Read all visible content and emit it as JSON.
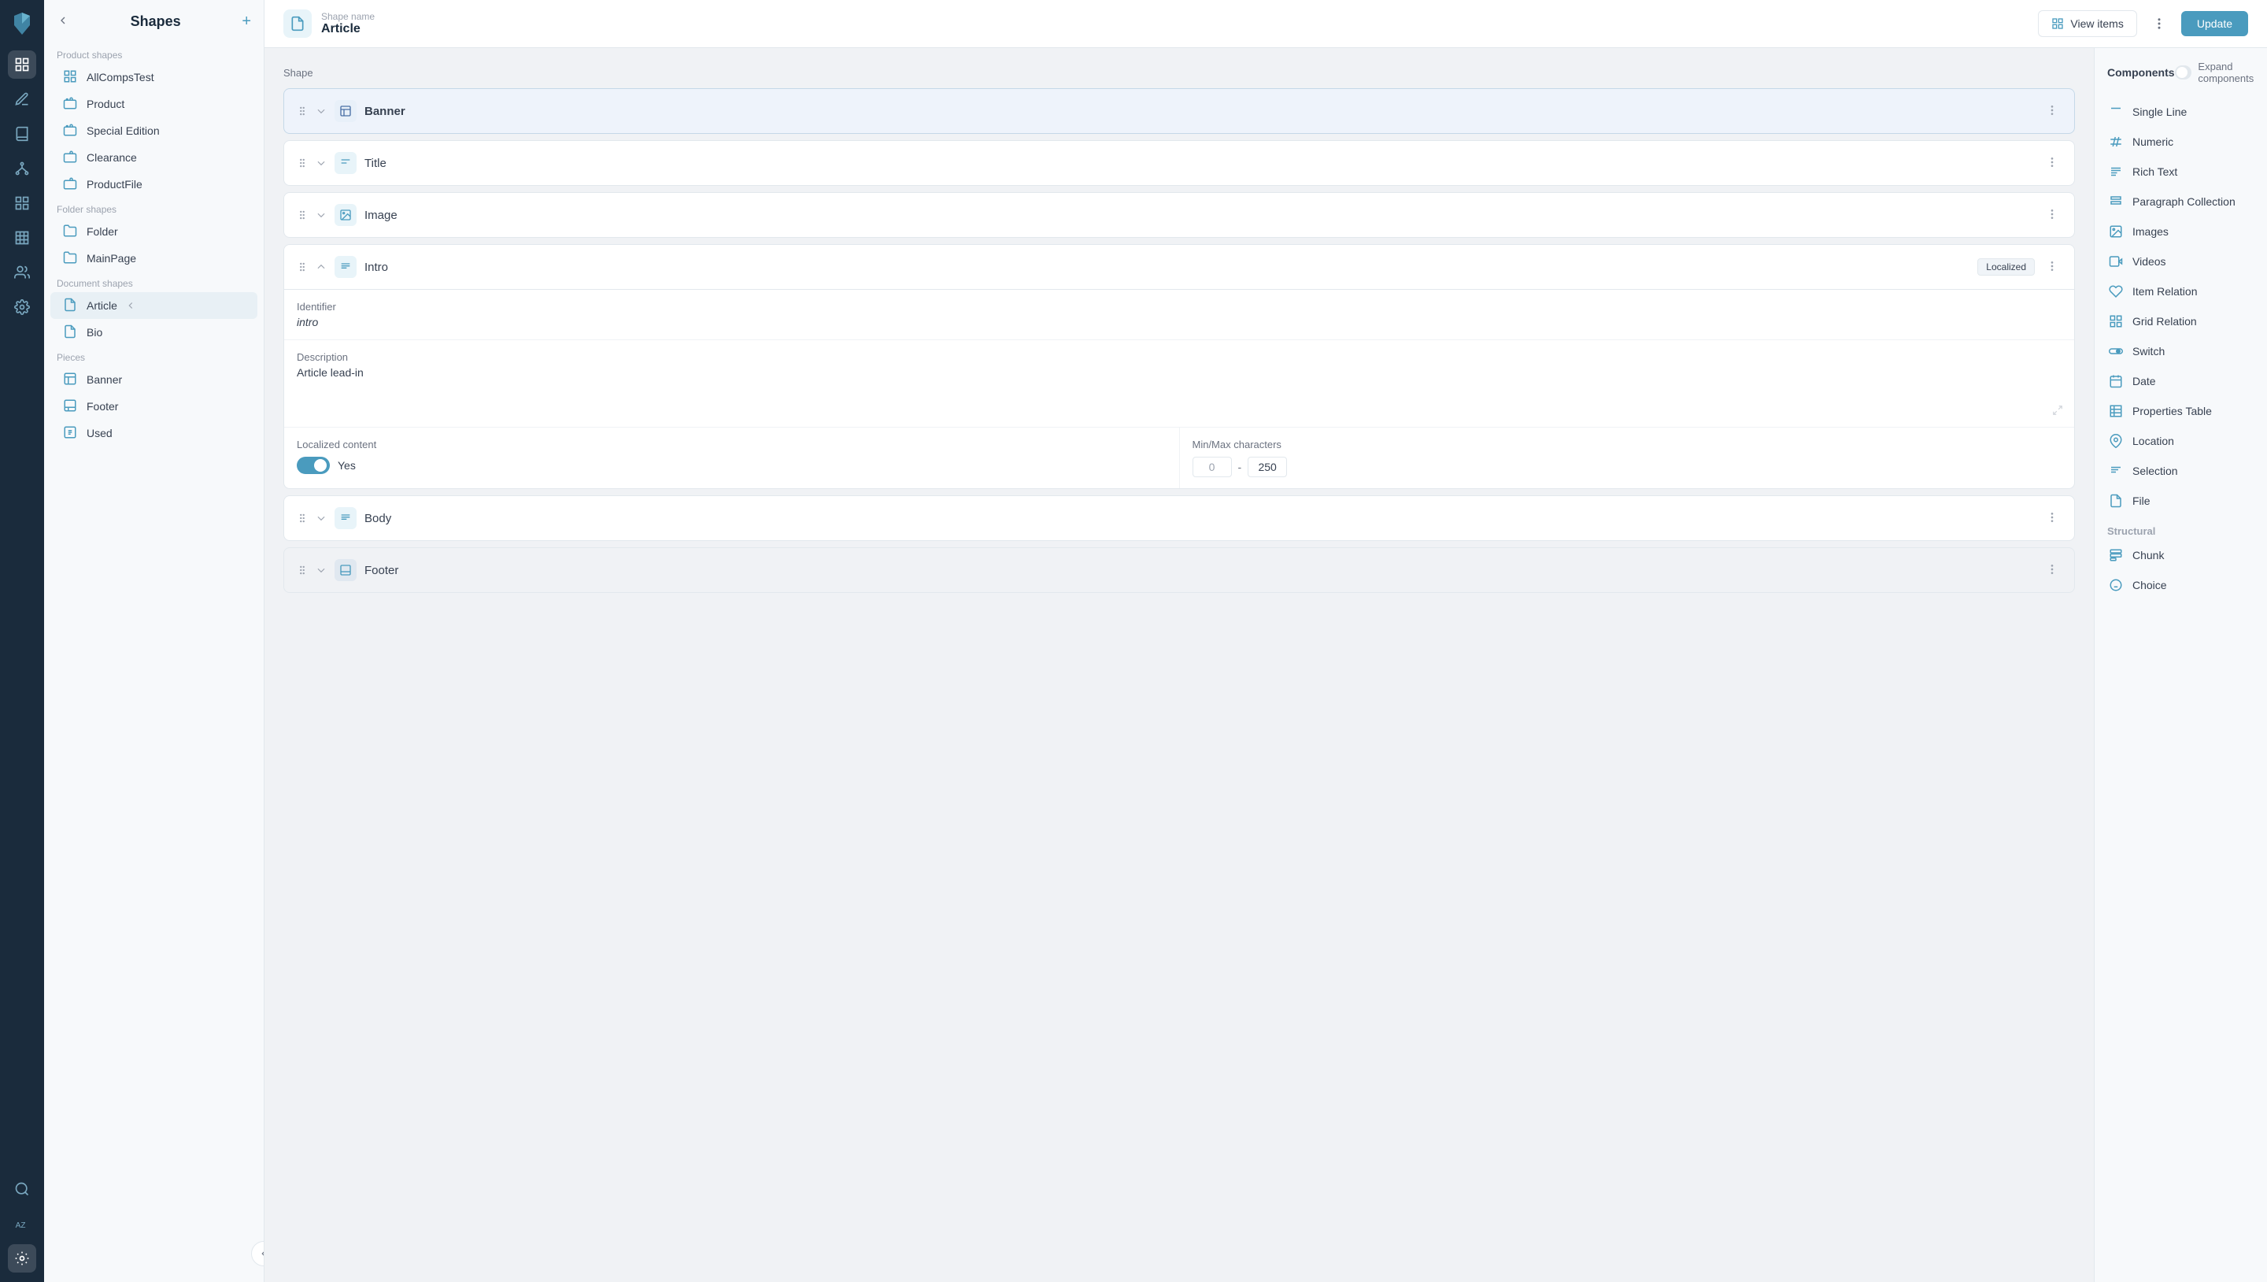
{
  "app": {
    "title": "Shapes"
  },
  "sidebar": {
    "back_label": "←",
    "add_label": "+",
    "title": "Shapes",
    "sections": [
      {
        "label": "Product shapes",
        "items": [
          {
            "id": "allcompstest",
            "label": "AllCompsTest",
            "icon": "grid"
          },
          {
            "id": "product",
            "label": "Product",
            "icon": "box"
          },
          {
            "id": "special-edition",
            "label": "Special Edition",
            "icon": "box"
          },
          {
            "id": "clearance",
            "label": "Clearance",
            "icon": "box"
          },
          {
            "id": "productfile",
            "label": "ProductFile",
            "icon": "box"
          }
        ]
      },
      {
        "label": "Folder shapes",
        "items": [
          {
            "id": "folder",
            "label": "Folder",
            "icon": "folder"
          },
          {
            "id": "mainpage",
            "label": "MainPage",
            "icon": "folder"
          }
        ]
      },
      {
        "label": "Document shapes",
        "items": [
          {
            "id": "article",
            "label": "Article",
            "icon": "doc",
            "active": true
          },
          {
            "id": "bio",
            "label": "Bio",
            "icon": "doc"
          }
        ]
      },
      {
        "label": "Pieces",
        "items": [
          {
            "id": "banner",
            "label": "Banner",
            "icon": "piece"
          },
          {
            "id": "footer",
            "label": "Footer",
            "icon": "piece"
          },
          {
            "id": "used",
            "label": "Used",
            "icon": "piece"
          }
        ]
      }
    ]
  },
  "topbar": {
    "shape_name_label": "Shape name",
    "shape_name": "Article",
    "view_items_label": "View items",
    "update_label": "Update"
  },
  "editor": {
    "section_label": "Shape",
    "expand_components_label": "Expand components",
    "rows": [
      {
        "id": "banner",
        "label": "Banner",
        "type": "piece",
        "active": true,
        "expanded": false
      },
      {
        "id": "title",
        "label": "Title",
        "type": "single-line",
        "active": false,
        "expanded": false
      },
      {
        "id": "image",
        "label": "Image",
        "type": "image",
        "active": false,
        "expanded": false
      },
      {
        "id": "intro",
        "label": "Intro",
        "type": "rich-text",
        "active": false,
        "expanded": true,
        "badge": "Localized",
        "identifier": "intro",
        "description": "Article lead-in",
        "localized_label": "Localized content",
        "localized_value": "Yes",
        "minmax_label": "Min/Max characters",
        "min_value": "0",
        "max_value": "250"
      },
      {
        "id": "body",
        "label": "Body",
        "type": "rich-text",
        "active": false,
        "expanded": false
      },
      {
        "id": "footer",
        "label": "Footer",
        "type": "piece",
        "active": false,
        "expanded": false
      }
    ]
  },
  "components": {
    "title": "Components",
    "expand_label": "Expand components",
    "items": [
      {
        "id": "single-line",
        "label": "Single Line",
        "icon": "single-line"
      },
      {
        "id": "numeric",
        "label": "Numeric",
        "icon": "numeric"
      },
      {
        "id": "rich-text",
        "label": "Rich Text",
        "icon": "rich-text"
      },
      {
        "id": "paragraph-collection",
        "label": "Paragraph Collection",
        "icon": "paragraph"
      },
      {
        "id": "images",
        "label": "Images",
        "icon": "images"
      },
      {
        "id": "videos",
        "label": "Videos",
        "icon": "videos"
      },
      {
        "id": "item-relation",
        "label": "Item Relation",
        "icon": "item-relation"
      },
      {
        "id": "grid-relation",
        "label": "Grid Relation",
        "icon": "grid-relation"
      },
      {
        "id": "switch",
        "label": "Switch",
        "icon": "switch"
      },
      {
        "id": "date",
        "label": "Date",
        "icon": "date"
      },
      {
        "id": "properties-table",
        "label": "Properties Table",
        "icon": "properties-table"
      },
      {
        "id": "location",
        "label": "Location",
        "icon": "location"
      },
      {
        "id": "selection",
        "label": "Selection",
        "icon": "selection"
      },
      {
        "id": "file",
        "label": "File",
        "icon": "file"
      }
    ],
    "structural_label": "Structural",
    "structural_items": [
      {
        "id": "chunk",
        "label": "Chunk",
        "icon": "chunk"
      },
      {
        "id": "choice",
        "label": "Choice",
        "icon": "choice"
      }
    ]
  }
}
